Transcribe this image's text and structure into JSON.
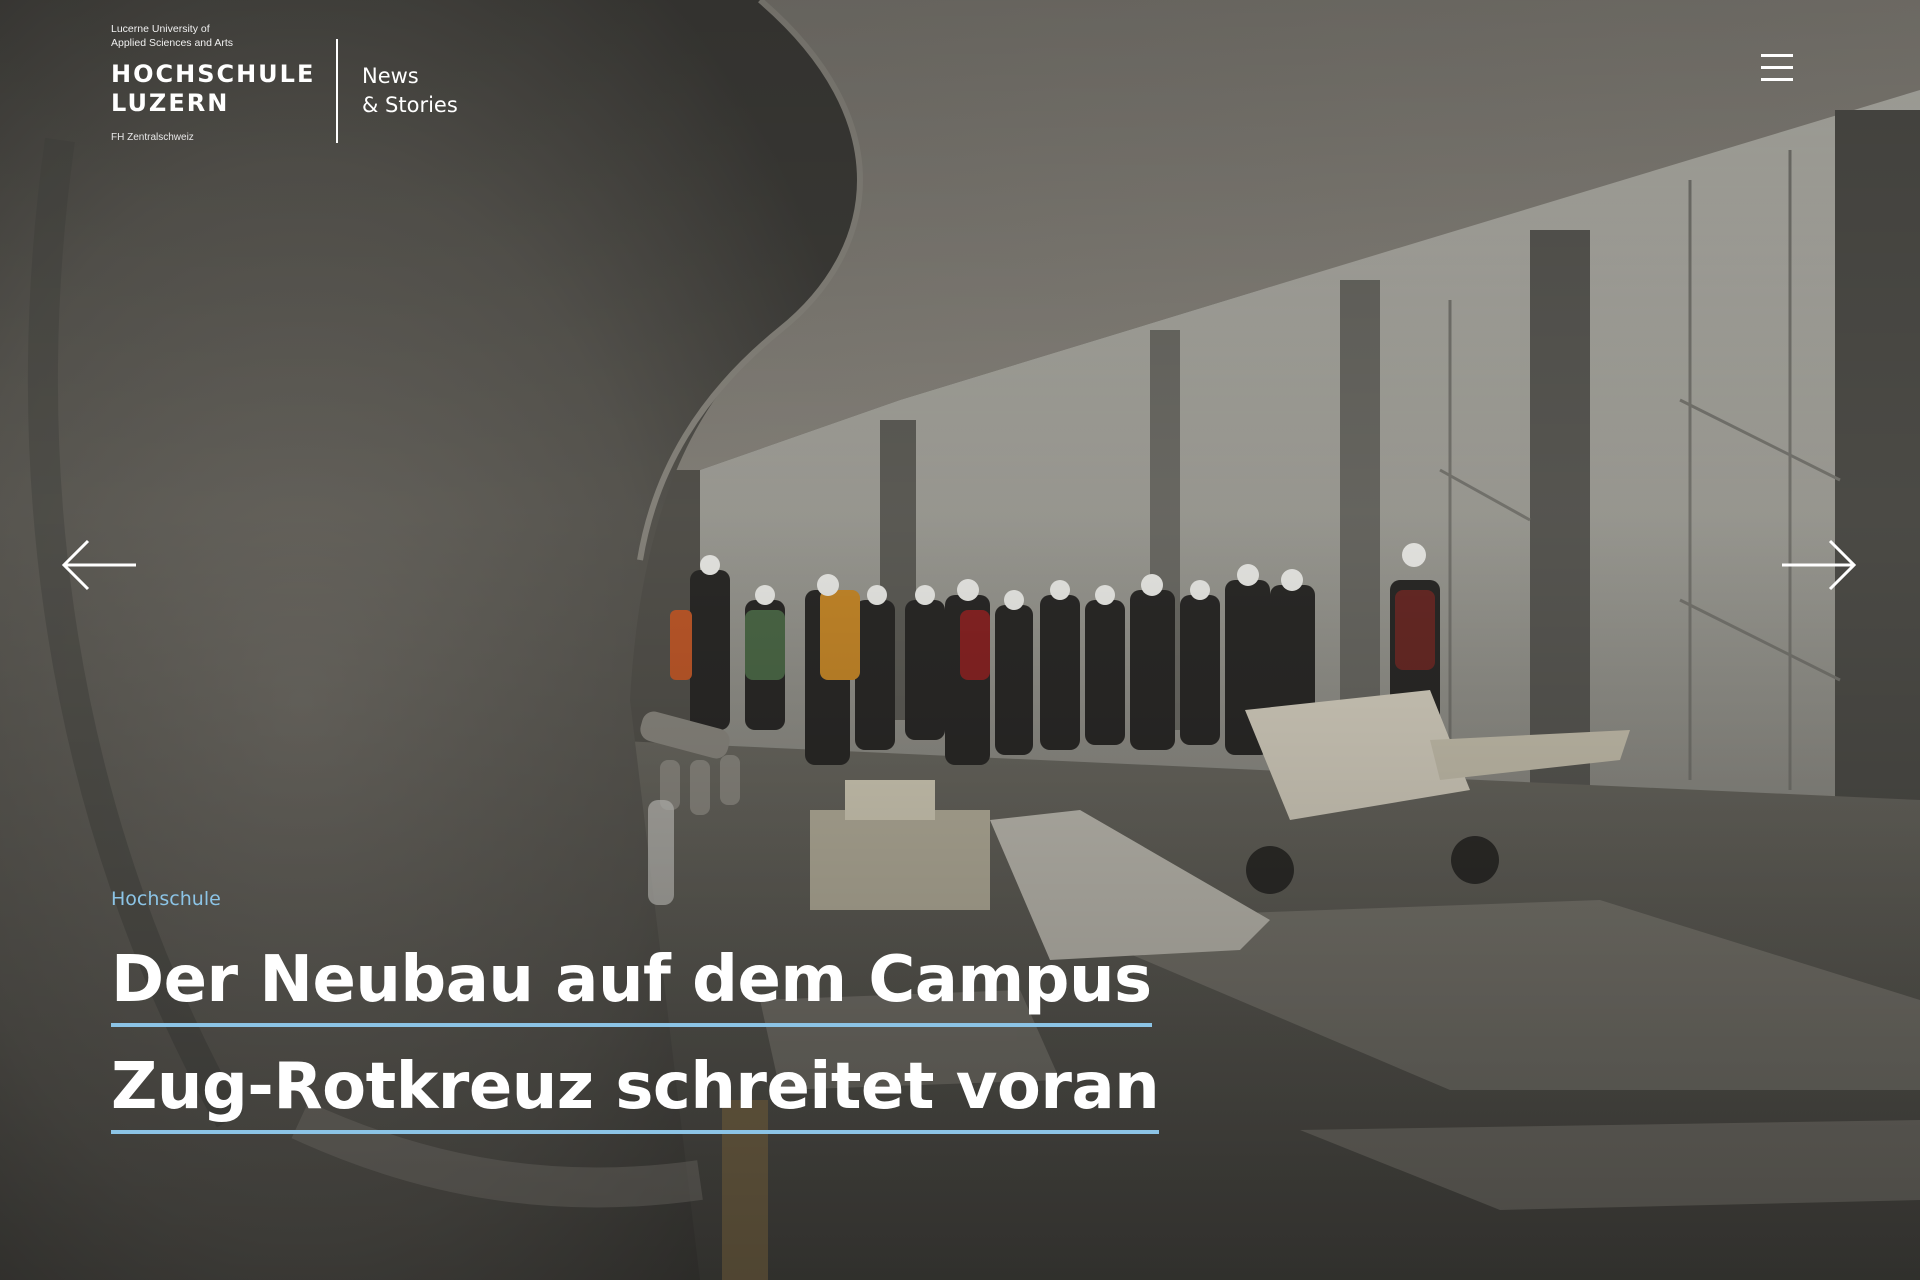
{
  "brand": {
    "tagline_line1": "Lucerne University of",
    "tagline_line2": "Applied Sciences and Arts",
    "name_line1": "HOCHSCHULE",
    "name_line2": "LUZERN",
    "subline": "FH Zentralschweiz",
    "section_line1": "News",
    "section_line2": "& Stories"
  },
  "navigation": {
    "menu_icon": "hamburger-menu-icon",
    "prev_icon": "arrow-left-icon",
    "next_icon": "arrow-right-icon"
  },
  "article": {
    "category": "Hochschule",
    "headline_line1": "Der Neubau auf dem Campus",
    "headline_line2": "Zug-Rotkreuz schreitet voran"
  },
  "colors": {
    "accent": "#8cc4e6",
    "text": "#ffffff"
  }
}
